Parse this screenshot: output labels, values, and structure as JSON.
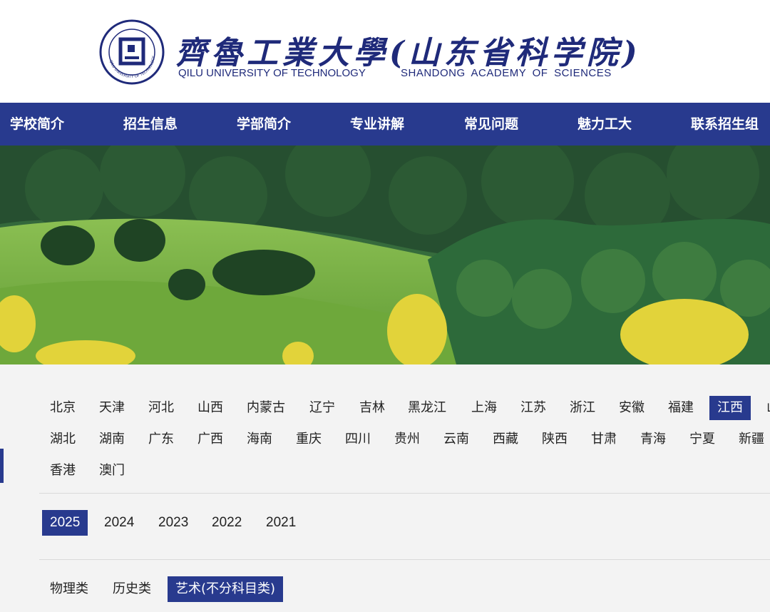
{
  "header": {
    "cn_name": "齊魯工業大學(山东省科学院)",
    "en_name_left": "QILU UNIVERSITY OF TECHNOLOGY",
    "en_name_right": "SHANDONG ACADEMY OF SCIENCES",
    "seal_text": "QILU UNIVERSITY OF TECHNOLOGY"
  },
  "nav": {
    "items": [
      "学校简介",
      "招生信息",
      "学部简介",
      "专业讲解",
      "常见问题",
      "魅力工大",
      "联系招生组"
    ]
  },
  "provinces": {
    "row1": [
      "北京",
      "天津",
      "河北",
      "山西",
      "内蒙古",
      "辽宁",
      "吉林",
      "黑龙江",
      "上海",
      "江苏",
      "浙江",
      "安徽",
      "福建",
      "江西",
      "山"
    ],
    "row2": [
      "湖北",
      "湖南",
      "广东",
      "广西",
      "海南",
      "重庆",
      "四川",
      "贵州",
      "云南",
      "西藏",
      "陕西",
      "甘肃",
      "青海",
      "宁夏",
      "新疆"
    ],
    "row3": [
      "香港",
      "澳门"
    ],
    "selected": "江西"
  },
  "years": {
    "items": [
      "2025",
      "2024",
      "2023",
      "2022",
      "2021"
    ],
    "selected": "2025"
  },
  "categories": {
    "items": [
      "物理类",
      "历史类",
      "艺术(不分科目类)"
    ],
    "selected": "艺术(不分科目类)"
  },
  "colors": {
    "brand": "#283a8e",
    "header_text": "#1f2a7a",
    "content_bg": "#f3f3f3"
  }
}
